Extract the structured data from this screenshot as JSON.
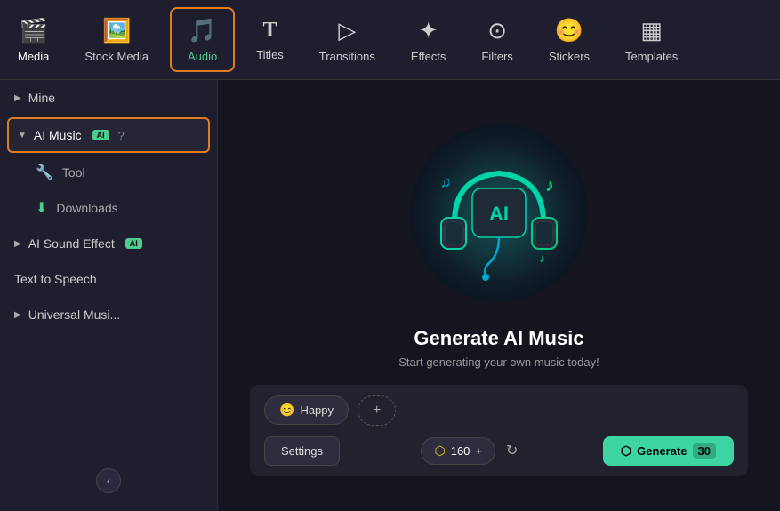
{
  "toolbar": {
    "items": [
      {
        "id": "media",
        "label": "Media",
        "icon": "🎬"
      },
      {
        "id": "stock-media",
        "label": "Stock Media",
        "icon": "🖼"
      },
      {
        "id": "audio",
        "label": "Audio",
        "icon": "🎵"
      },
      {
        "id": "titles",
        "label": "Titles",
        "icon": "T"
      },
      {
        "id": "transitions",
        "label": "Transitions",
        "icon": "▷"
      },
      {
        "id": "effects",
        "label": "Effects",
        "icon": "✦"
      },
      {
        "id": "filters",
        "label": "Filters",
        "icon": "⊙"
      },
      {
        "id": "stickers",
        "label": "Stickers",
        "icon": "🙂"
      },
      {
        "id": "templates",
        "label": "Templates",
        "icon": "▦"
      }
    ]
  },
  "sidebar": {
    "mine_label": "Mine",
    "ai_music_label": "AI Music",
    "tool_label": "Tool",
    "downloads_label": "Downloads",
    "ai_sound_effect_label": "AI Sound Effect",
    "text_to_speech_label": "Text to Speech",
    "universal_music_label": "Universal Musi...",
    "collapse_icon": "‹"
  },
  "content": {
    "title": "Generate AI Music",
    "subtitle": "Start generating your own music today!",
    "mood": {
      "tag_label": "Happy",
      "add_label": "+"
    },
    "controls": {
      "settings_label": "Settings",
      "credits_value": "160",
      "generate_label": "Generate",
      "generate_count": "30"
    }
  }
}
